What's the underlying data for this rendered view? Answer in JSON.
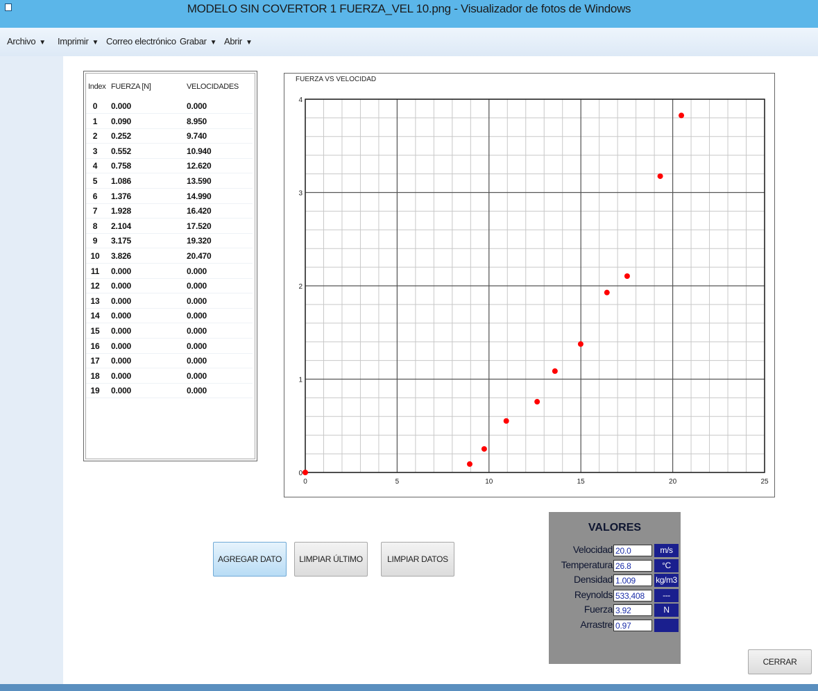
{
  "window": {
    "title": "MODELO SIN COVERTOR 1 FUERZA_VEL 10.png - Visualizador de fotos de Windows"
  },
  "menu": [
    {
      "label": "Archivo",
      "arrow": "▼"
    },
    {
      "label": "Imprimir",
      "arrow": "▼"
    },
    {
      "label": "Correo electrónico",
      "arrow": ""
    },
    {
      "label": "Grabar",
      "arrow": "▼"
    },
    {
      "label": "Abrir",
      "arrow": "▼"
    }
  ],
  "table": {
    "headers": [
      "Index",
      "FUERZA [N]",
      "VELOCIDADES"
    ],
    "rows": [
      [
        "0",
        "0.000",
        "0.000"
      ],
      [
        "1",
        "0.090",
        "8.950"
      ],
      [
        "2",
        "0.252",
        "9.740"
      ],
      [
        "3",
        "0.552",
        "10.940"
      ],
      [
        "4",
        "0.758",
        "12.620"
      ],
      [
        "5",
        "1.086",
        "13.590"
      ],
      [
        "6",
        "1.376",
        "14.990"
      ],
      [
        "7",
        "1.928",
        "16.420"
      ],
      [
        "8",
        "2.104",
        "17.520"
      ],
      [
        "9",
        "3.175",
        "19.320"
      ],
      [
        "10",
        "3.826",
        "20.470"
      ],
      [
        "11",
        "0.000",
        "0.000"
      ],
      [
        "12",
        "0.000",
        "0.000"
      ],
      [
        "13",
        "0.000",
        "0.000"
      ],
      [
        "14",
        "0.000",
        "0.000"
      ],
      [
        "15",
        "0.000",
        "0.000"
      ],
      [
        "16",
        "0.000",
        "0.000"
      ],
      [
        "17",
        "0.000",
        "0.000"
      ],
      [
        "18",
        "0.000",
        "0.000"
      ],
      [
        "19",
        "0.000",
        "0.000"
      ]
    ]
  },
  "chart_data": {
    "type": "scatter",
    "title": "FUERZA VS VELOCIDAD",
    "xlabel": "",
    "ylabel": "",
    "xlim": [
      0,
      25
    ],
    "ylim": [
      0,
      4
    ],
    "xticks": [
      0,
      5,
      10,
      15,
      20,
      25
    ],
    "yticks": [
      0,
      1,
      2,
      3,
      4
    ],
    "grid": true,
    "marker_color": "#ff0000",
    "series": [
      {
        "x": [
          0.0,
          8.95,
          9.74,
          10.94,
          12.62,
          13.59,
          14.99,
          16.42,
          17.52,
          19.32,
          20.47
        ],
        "y": [
          0.0,
          0.09,
          0.252,
          0.552,
          0.758,
          1.086,
          1.376,
          1.928,
          2.104,
          3.175,
          3.826
        ]
      }
    ]
  },
  "buttons": {
    "agregar": "AGREGAR DATO",
    "limpiar_ultimo": "LIMPIAR ÚLTIMO",
    "limpiar_datos": "LIMPIAR DATOS",
    "cerrar": "CERRAR"
  },
  "valores": {
    "title": "VALORES",
    "rows": [
      {
        "label": "Velocidad",
        "value": "20.0",
        "unit": "m/s"
      },
      {
        "label": "Temperatura",
        "value": "26.8",
        "unit": "°C"
      },
      {
        "label": "Densidad",
        "value": "1.009",
        "unit": "kg/m3"
      },
      {
        "label": "Reynolds",
        "value": "533,408",
        "unit": "---"
      },
      {
        "label": "Fuerza",
        "value": "3.92",
        "unit": "N"
      },
      {
        "label": "Arrastre",
        "value": "0.97",
        "unit": ""
      }
    ]
  }
}
